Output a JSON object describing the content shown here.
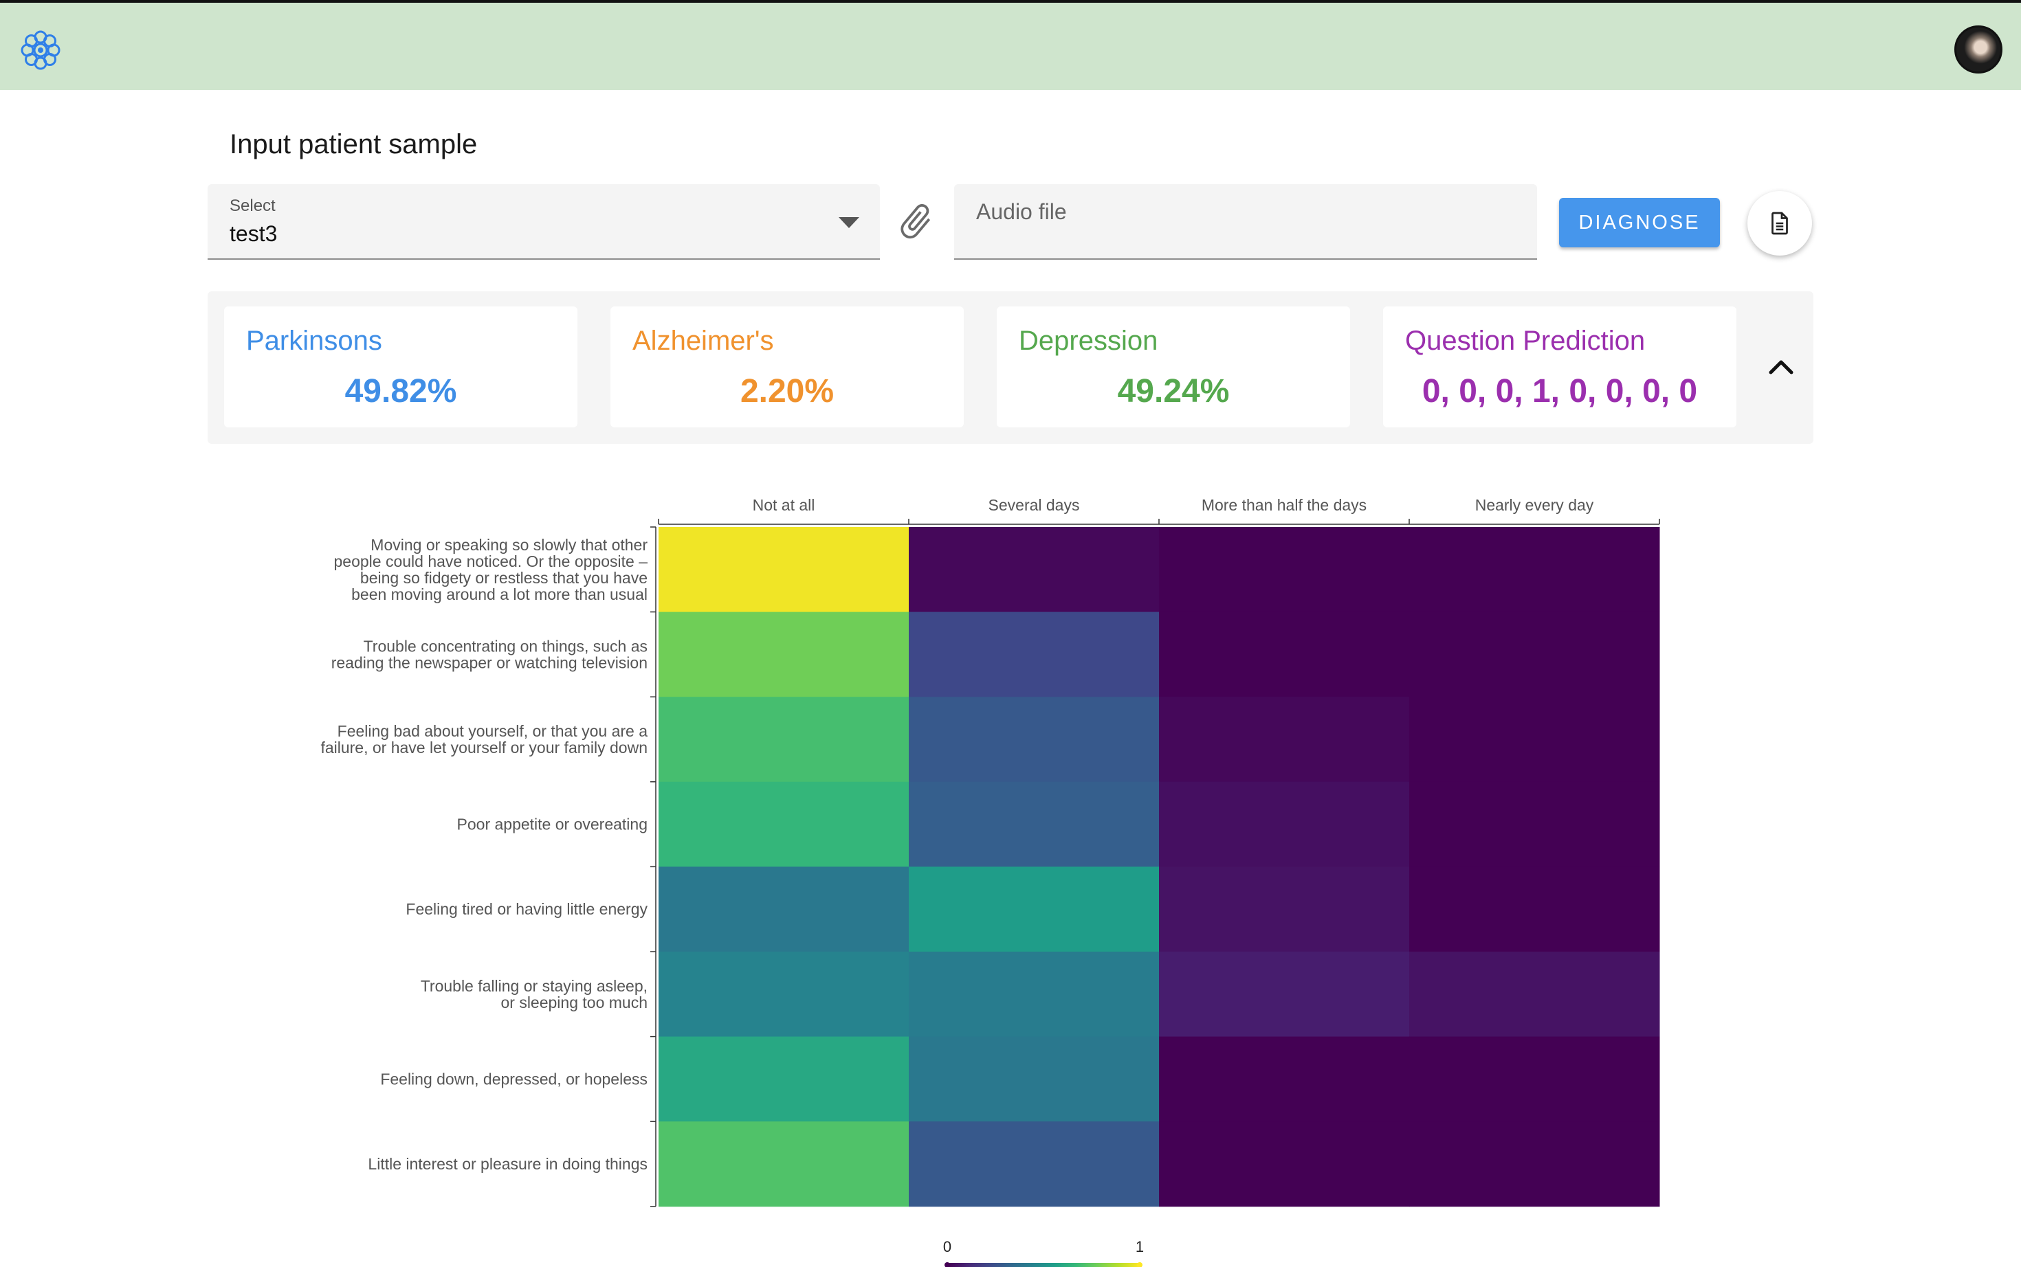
{
  "header": {
    "logo_icon": "flower-logo-icon",
    "avatar_icon": "user-avatar"
  },
  "form": {
    "title": "Input patient sample",
    "select_label": "Select",
    "select_value": "test3",
    "audio_placeholder": "Audio file",
    "diagnose_label": "DIAGNOSE"
  },
  "results": [
    {
      "title": "Parkinsons",
      "value": "49.82%",
      "color": "#3f8ee6"
    },
    {
      "title": "Alzheimer's",
      "value": "2.20%",
      "color": "#f0922e"
    },
    {
      "title": "Depression",
      "value": "49.24%",
      "color": "#55a84e"
    },
    {
      "title": "Question Prediction",
      "value": "0, 0, 0, 1, 0, 0, 0, 0",
      "color": "#9b2fae"
    }
  ],
  "chart_data": {
    "type": "heatmap",
    "colormap": "viridis",
    "x_categories": [
      "Not at all",
      "Several days",
      "More than half the days",
      "Nearly every day"
    ],
    "y_categories": [
      [
        "Moving or speaking so slowly that other",
        "people could have noticed. Or the opposite –",
        "being so fidgety or restless that you have",
        "been moving around a lot more than usual"
      ],
      [
        "Trouble concentrating on things, such as",
        "reading the newspaper or watching television"
      ],
      [
        "Feeling bad about yourself, or that you are a",
        "failure, or have let yourself or your family down"
      ],
      [
        "Poor appetite or overeating"
      ],
      [
        "Feeling tired or having little energy"
      ],
      [
        "Trouble falling or staying asleep,",
        "or sleeping too much"
      ],
      [
        "Feeling down, depressed, or hopeless"
      ],
      [
        "Little interest or pleasure in doing things"
      ]
    ],
    "values": [
      [
        0.98,
        0.02,
        0.0,
        0.0
      ],
      [
        0.78,
        0.22,
        0.0,
        0.0
      ],
      [
        0.7,
        0.28,
        0.02,
        0.0
      ],
      [
        0.66,
        0.3,
        0.04,
        0.0
      ],
      [
        0.4,
        0.55,
        0.05,
        0.0
      ],
      [
        0.45,
        0.42,
        0.08,
        0.05
      ],
      [
        0.6,
        0.4,
        0.0,
        0.0
      ],
      [
        0.72,
        0.28,
        0.0,
        0.0
      ]
    ],
    "colorbar": {
      "min_label": "0",
      "max_label": "1",
      "range": [
        0,
        1
      ]
    }
  }
}
